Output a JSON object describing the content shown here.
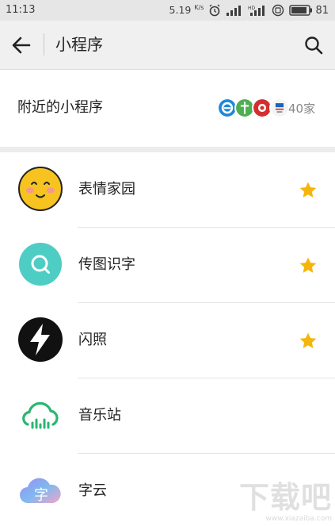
{
  "status_bar": {
    "time": "11:13",
    "net_speed": "5.19",
    "net_unit": "K/s",
    "battery": "81"
  },
  "nav": {
    "title": "小程序",
    "back_icon": "arrow-left-icon",
    "search_icon": "search-icon"
  },
  "nearby": {
    "label": "附近的小程序",
    "count": "40家",
    "logos": [
      "e-logo",
      "green-logo",
      "red-logo",
      "store-logo"
    ]
  },
  "apps": [
    {
      "name": "表情家园",
      "icon": "smiley-face-icon",
      "starred": true
    },
    {
      "name": "传图识字",
      "icon": "magnifier-circle-icon",
      "starred": true
    },
    {
      "name": "闪照",
      "icon": "lightning-icon",
      "starred": true
    },
    {
      "name": "音乐站",
      "icon": "music-cloud-icon",
      "starred": false
    },
    {
      "name": "字云",
      "icon": "word-cloud-icon",
      "starred": false
    }
  ],
  "watermark": {
    "logo": "下载吧",
    "url": "www.xiazaiba.com"
  },
  "colors": {
    "star": "#f5b50a",
    "status_bg": "#e6e6e6",
    "nav_bg": "#f0f0f0"
  }
}
